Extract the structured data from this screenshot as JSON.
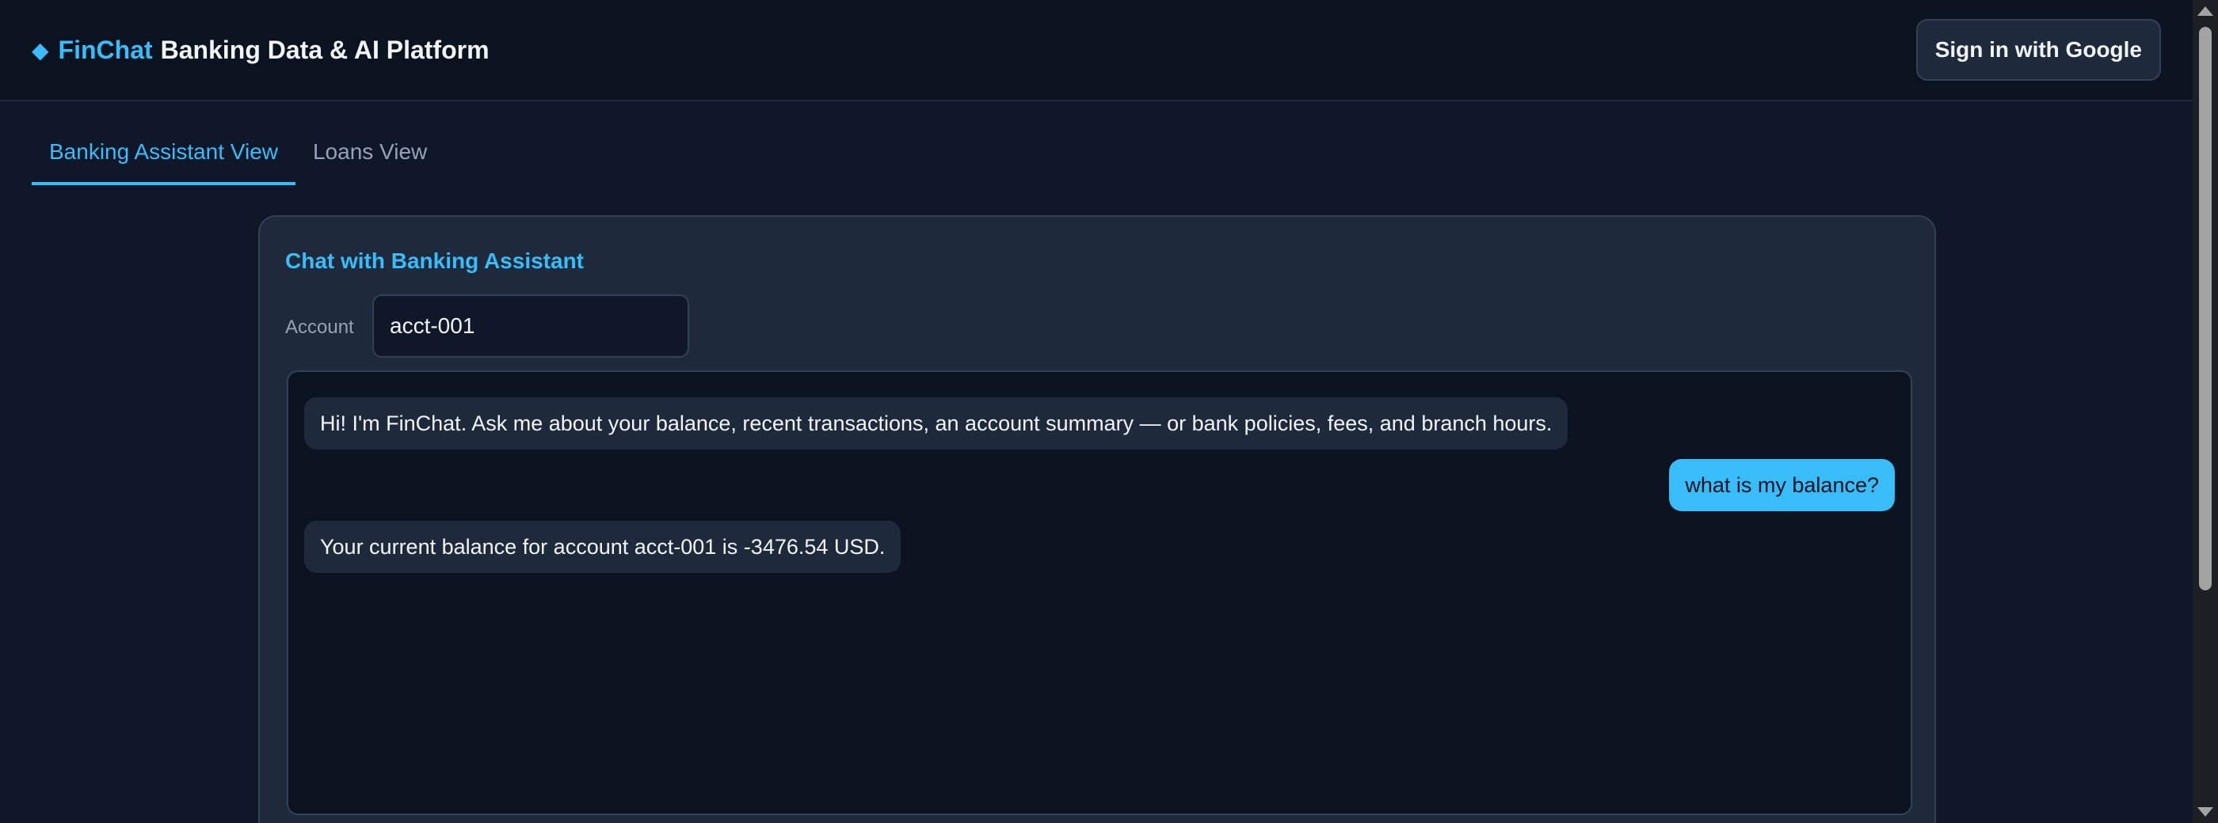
{
  "header": {
    "brand_icon": "diamond-icon",
    "brand_name": "FinChat",
    "brand_rest": "Banking Data & AI Platform",
    "signin_label": "Sign in with Google"
  },
  "tabs": [
    {
      "label": "Banking Assistant View",
      "active": true
    },
    {
      "label": "Loans View",
      "active": false
    }
  ],
  "chat": {
    "title": "Chat with Banking Assistant",
    "account_label": "Account",
    "account_value": "acct-001",
    "messages": [
      {
        "role": "assistant",
        "text": "Hi! I'm FinChat. Ask me about your balance, recent transactions, an account summary — or bank policies, fees, and branch hours."
      },
      {
        "role": "user",
        "text": "what is my balance?"
      },
      {
        "role": "assistant",
        "text": "Your current balance for account acct-001 is -3476.54 USD."
      }
    ]
  },
  "colors": {
    "accent": "#38bdf8",
    "background": "#0f1729",
    "header_bg": "#0b1220",
    "card_bg": "#1e293b"
  }
}
